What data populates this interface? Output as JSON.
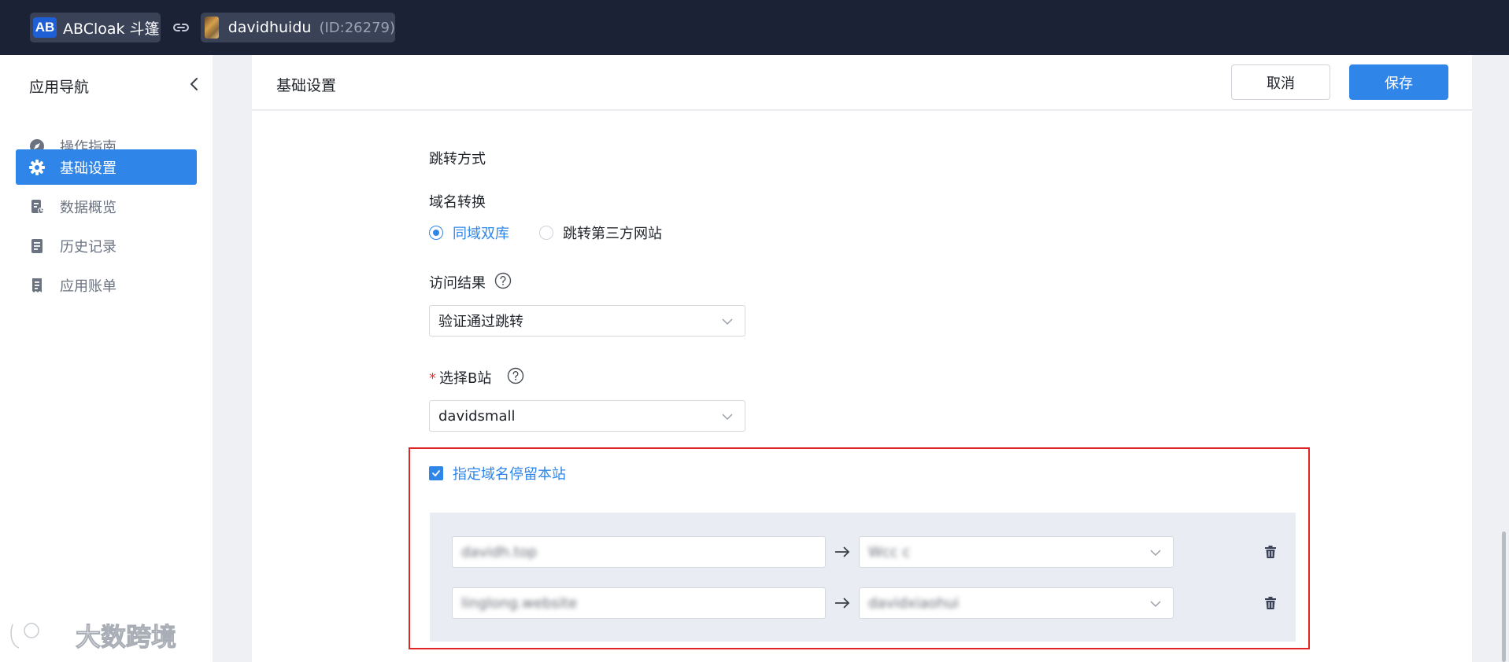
{
  "topbar": {
    "app_logo": "AB",
    "app_name": "ABCloak 斗篷",
    "user_name": "davidhuidu",
    "user_id": "(ID:26279)"
  },
  "sidebar": {
    "title": "应用导航",
    "items": [
      {
        "label": "操作指南",
        "icon": "compass-icon",
        "active": false
      },
      {
        "label": "基础设置",
        "icon": "gear-icon",
        "active": true
      },
      {
        "label": "数据概览",
        "icon": "data-report-icon",
        "active": false
      },
      {
        "label": "历史记录",
        "icon": "history-icon",
        "active": false
      },
      {
        "label": "应用账单",
        "icon": "bill-icon",
        "active": false
      }
    ]
  },
  "watermark": "大数跨境",
  "header": {
    "title": "基础设置",
    "cancel_label": "取消",
    "save_label": "保存"
  },
  "form": {
    "section_title": "跳转方式",
    "domain_convert_label": "域名转换",
    "radio_options": [
      {
        "label": "同域双库",
        "checked": true
      },
      {
        "label": "跳转第三方网站",
        "checked": false
      }
    ],
    "visit_result_label": "访问结果",
    "visit_result_value": "验证通过跳转",
    "select_b_label": "选择B站",
    "select_b_required_mark": "*",
    "select_b_value": "davidsmall",
    "stay_checkbox_label": "指定域名停留本站",
    "stay_checkbox_checked": true,
    "mappings": [
      {
        "domain": "davidh.top",
        "target": "Wcc c"
      },
      {
        "domain": "linglong.website",
        "target": "davidxiaohui"
      }
    ]
  },
  "colors": {
    "accent": "#2f86e8",
    "topbar_bg": "#1b2236",
    "highlight_border": "#e02424"
  }
}
